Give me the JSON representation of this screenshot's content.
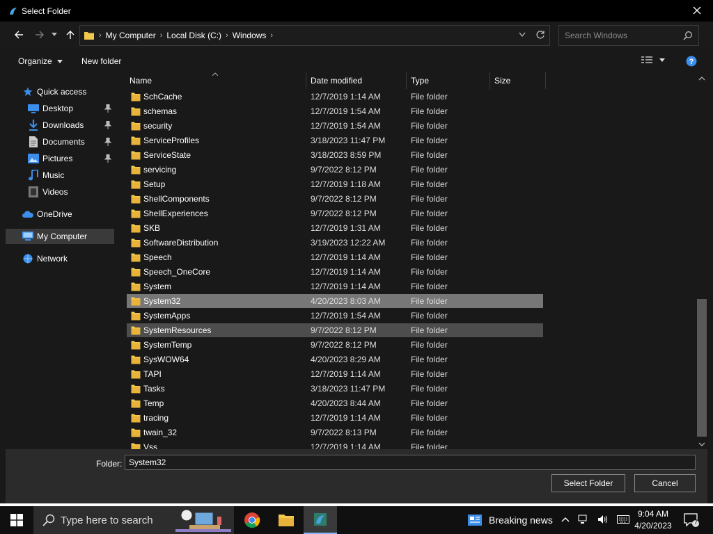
{
  "window": {
    "title": "Select Folder"
  },
  "address": {
    "crumbs": [
      "My Computer",
      "Local Disk (C:)",
      "Windows"
    ]
  },
  "search": {
    "placeholder": "Search Windows"
  },
  "toolbar": {
    "organize_label": "Organize",
    "new_folder_label": "New folder"
  },
  "nav": {
    "items": [
      {
        "label": "Quick access",
        "icon": "star-icon"
      },
      {
        "label": "Desktop",
        "icon": "desktop-icon",
        "pinned": true
      },
      {
        "label": "Downloads",
        "icon": "download-icon",
        "pinned": true
      },
      {
        "label": "Documents",
        "icon": "documents-icon",
        "pinned": true
      },
      {
        "label": "Pictures",
        "icon": "pictures-icon",
        "pinned": true
      },
      {
        "label": "Music",
        "icon": "music-icon"
      },
      {
        "label": "Videos",
        "icon": "videos-icon"
      },
      {
        "label": "OneDrive",
        "icon": "cloud-icon"
      },
      {
        "label": "My Computer",
        "icon": "computer-icon",
        "selected": true
      },
      {
        "label": "Network",
        "icon": "network-icon"
      }
    ]
  },
  "columns": {
    "name": "Name",
    "date": "Date modified",
    "type": "Type",
    "size": "Size"
  },
  "files": [
    {
      "name": "SchCache",
      "date": "12/7/2019 1:14 AM",
      "type": "File folder"
    },
    {
      "name": "schemas",
      "date": "12/7/2019 1:54 AM",
      "type": "File folder"
    },
    {
      "name": "security",
      "date": "12/7/2019 1:54 AM",
      "type": "File folder"
    },
    {
      "name": "ServiceProfiles",
      "date": "3/18/2023 11:47 PM",
      "type": "File folder"
    },
    {
      "name": "ServiceState",
      "date": "3/18/2023 8:59 PM",
      "type": "File folder"
    },
    {
      "name": "servicing",
      "date": "9/7/2022 8:12 PM",
      "type": "File folder"
    },
    {
      "name": "Setup",
      "date": "12/7/2019 1:18 AM",
      "type": "File folder"
    },
    {
      "name": "ShellComponents",
      "date": "9/7/2022 8:12 PM",
      "type": "File folder"
    },
    {
      "name": "ShellExperiences",
      "date": "9/7/2022 8:12 PM",
      "type": "File folder"
    },
    {
      "name": "SKB",
      "date": "12/7/2019 1:31 AM",
      "type": "File folder"
    },
    {
      "name": "SoftwareDistribution",
      "date": "3/19/2023 12:22 AM",
      "type": "File folder"
    },
    {
      "name": "Speech",
      "date": "12/7/2019 1:14 AM",
      "type": "File folder"
    },
    {
      "name": "Speech_OneCore",
      "date": "12/7/2019 1:14 AM",
      "type": "File folder"
    },
    {
      "name": "System",
      "date": "12/7/2019 1:14 AM",
      "type": "File folder"
    },
    {
      "name": "System32",
      "date": "4/20/2023 8:03 AM",
      "type": "File folder",
      "state": "selected"
    },
    {
      "name": "SystemApps",
      "date": "12/7/2019 1:54 AM",
      "type": "File folder"
    },
    {
      "name": "SystemResources",
      "date": "9/7/2022 8:12 PM",
      "type": "File folder",
      "state": "hover"
    },
    {
      "name": "SystemTemp",
      "date": "9/7/2022 8:12 PM",
      "type": "File folder"
    },
    {
      "name": "SysWOW64",
      "date": "4/20/2023 8:29 AM",
      "type": "File folder"
    },
    {
      "name": "TAPI",
      "date": "12/7/2019 1:14 AM",
      "type": "File folder"
    },
    {
      "name": "Tasks",
      "date": "3/18/2023 11:47 PM",
      "type": "File folder"
    },
    {
      "name": "Temp",
      "date": "4/20/2023 8:44 AM",
      "type": "File folder"
    },
    {
      "name": "tracing",
      "date": "12/7/2019 1:14 AM",
      "type": "File folder"
    },
    {
      "name": "twain_32",
      "date": "9/7/2022 8:13 PM",
      "type": "File folder"
    },
    {
      "name": "Vss",
      "date": "12/7/2019 1:14 AM",
      "type": "File folder"
    }
  ],
  "footer": {
    "folder_label": "Folder:",
    "folder_value": "System32",
    "select_button": "Select Folder",
    "cancel_button": "Cancel"
  },
  "taskbar": {
    "search_placeholder": "Type here to search",
    "news_label": "Breaking news",
    "time": "9:04 AM",
    "date": "4/20/2023",
    "notification_count": "7"
  },
  "colors": {
    "folder": "#f2c94c",
    "accent": "#3b8eea",
    "selected_row": "#777777",
    "hover_row": "#4d4d4d"
  }
}
